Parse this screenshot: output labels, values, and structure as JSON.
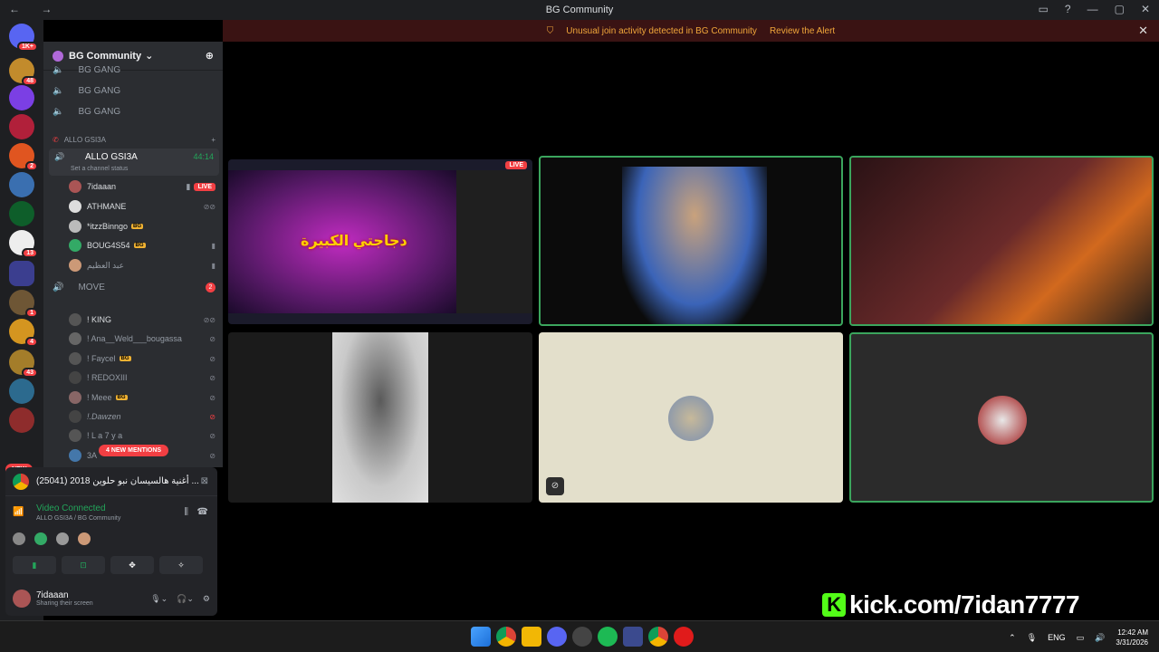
{
  "window": {
    "title": "BG Community"
  },
  "alert": {
    "text": "Unusual join activity detected in BG Community",
    "action": "Review the Alert"
  },
  "guild_badges": {
    "top": "1K+",
    "g2": "48",
    "g3": "2",
    "g4": "13",
    "g5": "1",
    "g6": "4",
    "g7": "43"
  },
  "new_pill": "NEW",
  "server": {
    "name": "BG Community"
  },
  "channels": {
    "bg_gang": [
      "BG GANG",
      "BG GANG",
      "BG GANG"
    ],
    "category": "ALLO GSI3A",
    "active_channel": "ALLO GSI3A",
    "active_timer": "44:14",
    "status_prompt": "Set a channel status",
    "members": [
      {
        "name": "7idaaan",
        "live": "LIVE"
      },
      {
        "name": "ATHMANE"
      },
      {
        "name": "*itzzBinngo",
        "tag": "BG"
      },
      {
        "name": "BOUG4S54",
        "tag": "BG"
      },
      {
        "name": "عبد العظيم"
      }
    ],
    "move_channel": "MOVE",
    "move_badge": "2",
    "move_members": [
      {
        "name": "! KING"
      },
      {
        "name": "! Ana__Weld___bougassa"
      },
      {
        "name": "! Faycel",
        "tag": "BG"
      },
      {
        "name": "! REDOXIII"
      },
      {
        "name": "!   Meee",
        "tag": "BG"
      },
      {
        "name": "!.Dawzen"
      },
      {
        "name": "! L a 7 y a"
      },
      {
        "name": "3A"
      }
    ],
    "mentions": "4 NEW MENTIONS"
  },
  "activity": {
    "text": "(25041) 2018 أغنية هالسيسان نبو حلوين ..."
  },
  "voice": {
    "status": "Video Connected",
    "location": "ALLO GSI3A / BG Community"
  },
  "user": {
    "name": "7idaaan",
    "status": "Sharing their screen"
  },
  "stream": {
    "live": "LIVE",
    "overlay_text": "دجاجتي الكبيرة"
  },
  "kick": {
    "text": "kick.com/7idan7777"
  },
  "tray": {
    "lang": "ENG",
    "time": "12:42 AM",
    "date": "3/31/2026"
  }
}
